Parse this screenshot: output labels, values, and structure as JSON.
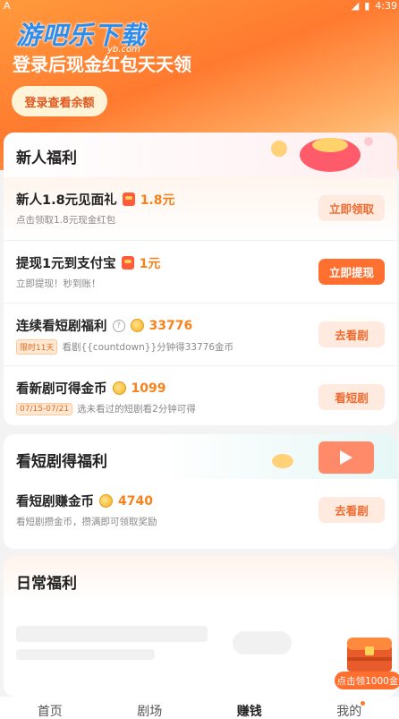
{
  "status_bar": {
    "left": "A",
    "time": "4:39"
  },
  "hero": {
    "watermark": "游吧乐下载",
    "watermark_sub": "yb.com",
    "title": "登录后现金红包天天领",
    "login_button": "登录查看余额"
  },
  "new_user_section": {
    "title": "新人福利",
    "items": [
      {
        "name": "新人1.8元见面礼",
        "amount": "1.8元",
        "amount_icon": "red-packet-icon",
        "desc": "点击领取1.8元现金红包",
        "button": "立即领取",
        "button_style": "light"
      },
      {
        "name": "提现1元到支付宝",
        "amount": "1元",
        "amount_icon": "red-packet-icon",
        "desc": "立即提现！秒到账！",
        "button": "立即提现",
        "button_style": "solid"
      },
      {
        "name": "连续看短剧福利",
        "amount": "33776",
        "amount_icon": "coin-icon",
        "tag": "限时11天",
        "desc": "看剧{{countdown}}分钟得33776金币",
        "button": "去看剧",
        "button_style": "light",
        "help_icon": "?"
      },
      {
        "name": "看新剧可得金币",
        "amount": "1099",
        "amount_icon": "coin-icon",
        "tag": "07/15-07/21",
        "desc": "选未看过的短剧看2分钟可得",
        "button": "看短剧",
        "button_style": "light"
      }
    ]
  },
  "drama_section": {
    "title": "看短剧得福利",
    "items": [
      {
        "name": "看短剧赚金币",
        "amount": "4740",
        "amount_icon": "coin-icon",
        "desc": "看短剧攒金币，攒满即可领取奖励",
        "button": "去看剧",
        "button_style": "light"
      }
    ]
  },
  "daily_section": {
    "title": "日常福利"
  },
  "floating_chest": {
    "label": "点击领1000金"
  },
  "bottom_nav": {
    "items": [
      {
        "label": "首页",
        "active": false
      },
      {
        "label": "剧场",
        "active": false
      },
      {
        "label": "赚钱",
        "active": true
      },
      {
        "label": "我的",
        "active": false,
        "badge_dot": true
      }
    ]
  },
  "colors": {
    "accent": "#ff6f2f",
    "amount": "#f7821b",
    "hero_start": "#ff9a3c"
  }
}
